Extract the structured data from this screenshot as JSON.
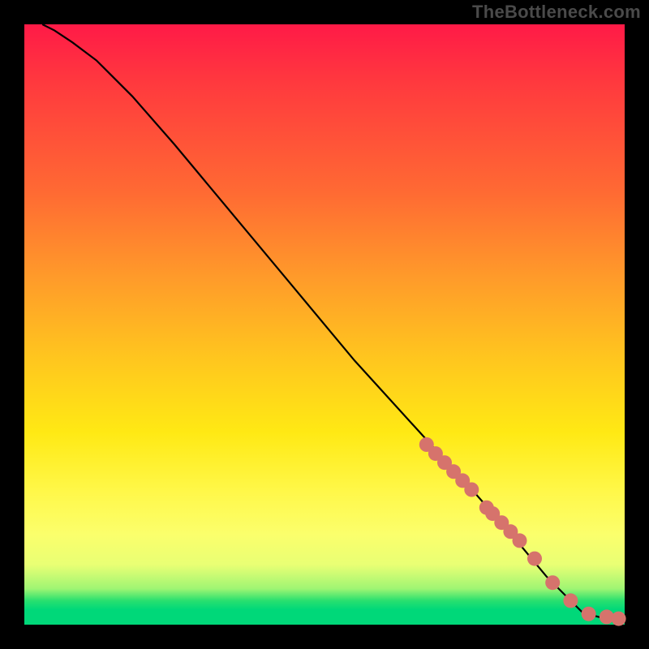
{
  "watermark": "TheBottleneck.com",
  "chart_data": {
    "type": "line",
    "title": "",
    "xlabel": "",
    "ylabel": "",
    "xlim": [
      0,
      100
    ],
    "ylim": [
      0,
      100
    ],
    "curve": {
      "name": "bottleneck-curve",
      "x": [
        3,
        5,
        8,
        12,
        18,
        25,
        35,
        45,
        55,
        65,
        75,
        82,
        87,
        90,
        93,
        96,
        99
      ],
      "y": [
        100,
        99,
        97,
        94,
        88,
        80,
        68,
        56,
        44,
        33,
        22,
        14,
        8,
        5,
        2,
        1.2,
        1
      ]
    },
    "markers": {
      "name": "highlight-points",
      "color": "#d6736c",
      "x": [
        67,
        68.5,
        70,
        71.5,
        73,
        74.5,
        77,
        78,
        79.5,
        81,
        82.5,
        85,
        88,
        91,
        94,
        97,
        99
      ],
      "y": [
        30,
        28.5,
        27,
        25.5,
        24,
        22.5,
        19.5,
        18.5,
        17,
        15.5,
        14,
        11,
        7,
        4,
        1.8,
        1.3,
        1
      ]
    },
    "gradient_bands": [
      {
        "color": "#ff1a47",
        "stop": 0
      },
      {
        "color": "#ffe914",
        "stop": 68
      },
      {
        "color": "#00d879",
        "stop": 97
      }
    ]
  }
}
